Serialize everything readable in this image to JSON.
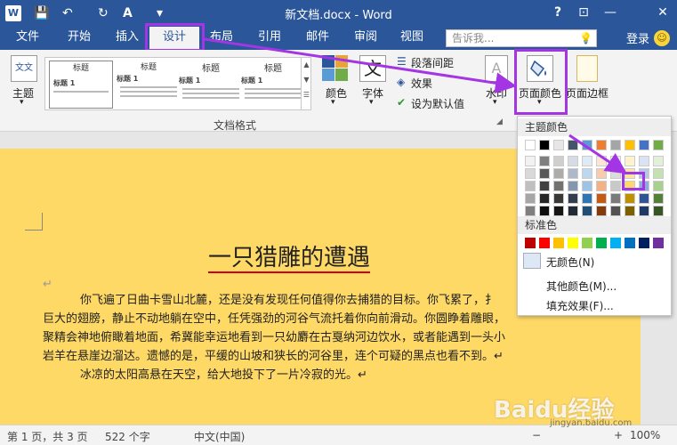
{
  "window": {
    "title": "新文档.docx - Word",
    "help": "?",
    "restore": "⊡",
    "minimize": "—",
    "close": "✕"
  },
  "quick_access": {
    "logo": "W",
    "save": "💾",
    "undo": "↶",
    "redo": "↻",
    "format": "A",
    "customize": "▾"
  },
  "tabs": [
    "文件",
    "开始",
    "插入",
    "设计",
    "布局",
    "引用",
    "邮件",
    "审阅",
    "视图"
  ],
  "active_tab": "设计",
  "tell_me": {
    "placeholder": "告诉我...",
    "bulb": "💡"
  },
  "account": {
    "login": "登录",
    "smiley": "☺"
  },
  "ribbon": {
    "theme_label": "主题",
    "theme_icon_text": "文文",
    "gallery_items": [
      {
        "heading": "标题",
        "sub": "标题 1"
      },
      {
        "heading": "标题",
        "sub": "标题 1"
      },
      {
        "heading": "标题",
        "sub": "标题 1"
      },
      {
        "heading": "标题",
        "sub": "标题 1"
      }
    ],
    "group_label": "文档格式",
    "colors_label": "颜色",
    "fonts_label": "字体",
    "fonts_icon_text": "文",
    "paragraph_spacing": "段落间距",
    "effects": "效果",
    "set_default": "设为默认值",
    "watermark": "水印",
    "watermark_icon_text": "A",
    "page_color": "页面颜色",
    "page_border": "页面边框",
    "theme_colors_swatches": [
      "#2b579a",
      "#e8a33b",
      "#5b9bd5",
      "#70ad47"
    ],
    "chevron": "▾",
    "checkmark": "✔"
  },
  "dropdown": {
    "theme_colors_title": "主题颜色",
    "standard_colors_title": "标准色",
    "no_color": "无颜色(N)",
    "more_colors": "其他颜色(M)...",
    "fill_effects": "填充效果(F)...",
    "theme_color_columns": [
      [
        "#ffffff",
        "#f2f2f2",
        "#d9d9d9",
        "#bfbfbf",
        "#a6a6a6",
        "#7f7f7f"
      ],
      [
        "#000000",
        "#7f7f7f",
        "#595959",
        "#404040",
        "#262626",
        "#0d0d0d"
      ],
      [
        "#e7e6e6",
        "#d0cece",
        "#aeabab",
        "#757171",
        "#3b3838",
        "#171616"
      ],
      [
        "#44546a",
        "#d6dce4",
        "#adb9ca",
        "#8497b0",
        "#333f4f",
        "#222a35"
      ],
      [
        "#5b9bd5",
        "#deebf6",
        "#bdd7ee",
        "#9dc3e6",
        "#2e75b5",
        "#1f4e79"
      ],
      [
        "#ed7d31",
        "#fbe5d5",
        "#f7cbac",
        "#f4b183",
        "#c55a11",
        "#843c0b"
      ],
      [
        "#a5a5a5",
        "#ededed",
        "#dbdbdb",
        "#c9c9c9",
        "#7b7b7b",
        "#525252"
      ],
      [
        "#ffc000",
        "#fff2cc",
        "#ffe599",
        "#ffd966",
        "#bf9000",
        "#7f6000"
      ],
      [
        "#4472c4",
        "#dae3f3",
        "#b4c7e7",
        "#8faadc",
        "#2f5597",
        "#1f3864"
      ],
      [
        "#70ad47",
        "#e2efd9",
        "#c5e0b3",
        "#a9d18e",
        "#538135",
        "#375623"
      ]
    ],
    "standard_colors": [
      "#c00000",
      "#ff0000",
      "#ffc000",
      "#ffff00",
      "#92d050",
      "#00b050",
      "#00b0f0",
      "#0070c0",
      "#002060",
      "#7030a0"
    ]
  },
  "document": {
    "title": "一只猎雕的遭遇",
    "para_mark": "↵",
    "paragraph_lines": [
      "你飞遍了日曲卡雪山北麓，还是没有发现任何值得你去捕猎的目标。你飞累了，扌",
      "巨大的翅膀，静止不动地躺在空中，任凭强劲的河谷气流托着你向前滑动。你圆睁着雕眼，",
      "聚精会神地俯瞰着地面，希冀能幸运地看到一只幼麝在古戛纳河边饮水，或者能遇到一头小",
      "岩羊在悬崖边溜达。遗憾的是，平缓的山坡和狭长的河谷里，连个可疑的黑点也看不到。↵"
    ],
    "paragraph2": "冰凉的太阳高悬在天空，给大地投下了一片冷寂的光。↵"
  },
  "status": {
    "page": "第 1 页，共 3 页",
    "words": "522 个字",
    "language": "中文(中国)",
    "zoom": "100%",
    "zoom_minus": "−",
    "zoom_plus": "+"
  },
  "watermark": {
    "text": "Baidu经验",
    "sub": "jingyan.baidu.com"
  },
  "colors": {
    "titlebar": "#2b579a",
    "highlight": "#a335e4",
    "page_background": "#ffd966",
    "title_underline": "#c00000"
  }
}
